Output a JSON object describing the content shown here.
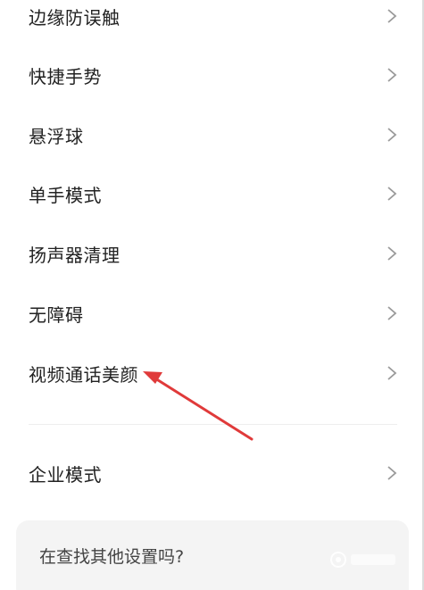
{
  "settings_list": {
    "items": [
      {
        "label": "边缘防误触"
      },
      {
        "label": "快捷手势"
      },
      {
        "label": "悬浮球"
      },
      {
        "label": "单手模式"
      },
      {
        "label": "扬声器清理"
      },
      {
        "label": "无障碍"
      },
      {
        "label": "视频通话美颜"
      }
    ],
    "enterprise_item": {
      "label": "企业模式"
    }
  },
  "search_suggestion": {
    "text": "在查找其他设置吗?"
  },
  "annotation": {
    "arrow_color": "#e03a3a",
    "target": "视频通话美颜"
  },
  "colors": {
    "text": "#222222",
    "chevron": "#9a9a9a",
    "card_bg": "#f4f4f4"
  }
}
